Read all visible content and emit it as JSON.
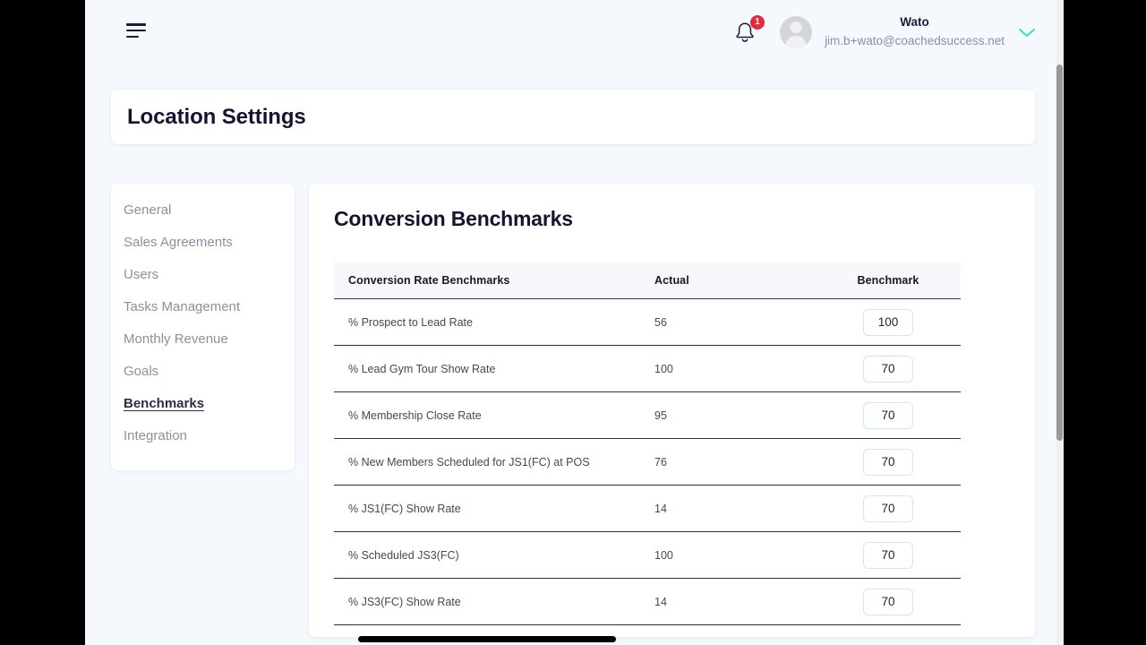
{
  "topbar": {
    "menu_icon": "hamburger-icon",
    "notifications": {
      "icon": "bell-icon",
      "badge_count": "1"
    },
    "avatar_icon": "user-avatar-placeholder",
    "user_name": "Wato",
    "user_email": "jim.b+wato@coachedsuccess.net",
    "dropdown_icon": "chevron-down-icon",
    "accent_color": "#3fd9c8",
    "badge_color": "#e8293b"
  },
  "page": {
    "title": "Location Settings",
    "background_color": "#f5f8fd"
  },
  "settings_nav": {
    "items": [
      {
        "label": "General",
        "active": false
      },
      {
        "label": "Sales Agreements",
        "active": false
      },
      {
        "label": "Users",
        "active": false
      },
      {
        "label": "Tasks Management",
        "active": false
      },
      {
        "label": "Monthly Revenue",
        "active": false
      },
      {
        "label": "Goals",
        "active": false
      },
      {
        "label": "Benchmarks",
        "active": true
      },
      {
        "label": "Integration",
        "active": false
      }
    ]
  },
  "content": {
    "title": "Conversion Benchmarks",
    "table": {
      "columns": [
        "Conversion Rate Benchmarks",
        "Actual",
        "Benchmark"
      ],
      "rows": [
        {
          "name": "% Prospect to Lead Rate",
          "actual": "56",
          "benchmark": "100"
        },
        {
          "name": "% Lead Gym Tour Show Rate",
          "actual": "100",
          "benchmark": "70"
        },
        {
          "name": "% Membership Close Rate",
          "actual": "95",
          "benchmark": "70"
        },
        {
          "name": "% New Members Scheduled for JS1(FC) at POS",
          "actual": "76",
          "benchmark": "70"
        },
        {
          "name": "% JS1(FC) Show Rate",
          "actual": "14",
          "benchmark": "70"
        },
        {
          "name": "% Scheduled JS3(FC)",
          "actual": "100",
          "benchmark": "70"
        },
        {
          "name": "% JS3(FC) Show Rate",
          "actual": "14",
          "benchmark": "70"
        }
      ],
      "input_border_color": "#cfe9ef"
    }
  },
  "scrollbars": {
    "horizontal_visible": true,
    "vertical_visible": true
  }
}
